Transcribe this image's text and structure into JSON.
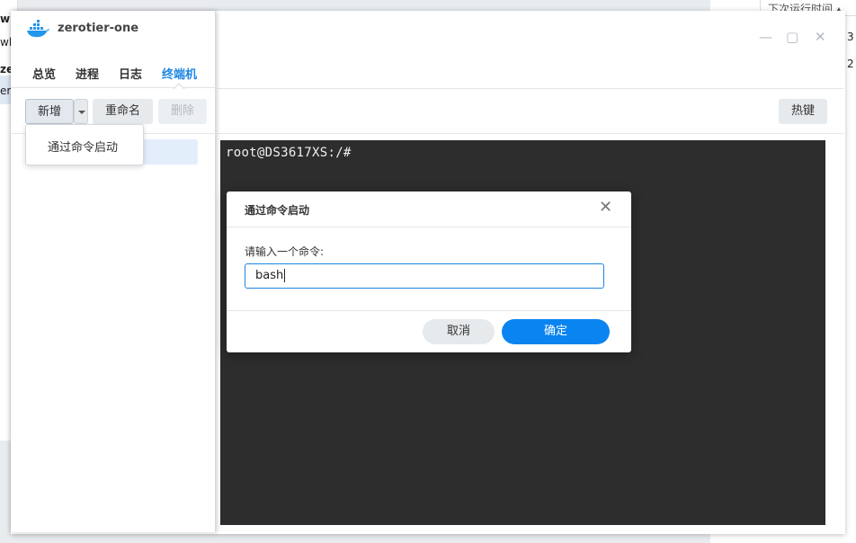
{
  "background": {
    "left_window_lines": [
      "wh",
      "wh",
      "ze",
      "er"
    ],
    "right_window_header": "下次运行时间",
    "right_window_values": [
      "3",
      "2"
    ]
  },
  "main_window": {
    "hotkey_label": "热键",
    "terminal_prompt": "root@DS3617XS:/#",
    "controls": {
      "minimize": "—",
      "maximize": "▢",
      "close": "✕"
    }
  },
  "app": {
    "title": "zerotier-one",
    "icon": "docker-whale-icon",
    "tabs": [
      {
        "label": "总览",
        "active": false
      },
      {
        "label": "进程",
        "active": false
      },
      {
        "label": "日志",
        "active": false
      },
      {
        "label": "终端机",
        "active": true
      }
    ],
    "toolbar": {
      "new_label": "新增",
      "rename_label": "重命名",
      "delete_label": "删除"
    },
    "dropdown_item": "通过命令启动"
  },
  "dialog": {
    "title": "通过命令启动",
    "label": "请输入一个命令:",
    "input_value": "bash",
    "cancel_label": "取消",
    "ok_label": "确定"
  },
  "colors": {
    "accent": "#1e86e0",
    "ok_button": "#0a84f0",
    "terminal_bg": "#2d2d2d"
  }
}
